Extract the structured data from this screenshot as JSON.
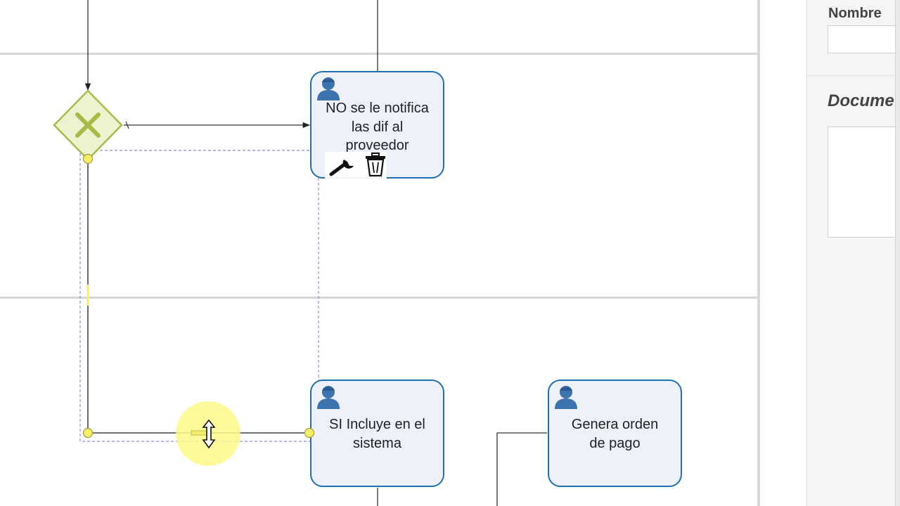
{
  "diagram": {
    "tasks": [
      {
        "id": "notifica",
        "label_lines": [
          "NO se le notifica",
          "las dif al",
          "proveedor"
        ]
      },
      {
        "id": "incluye",
        "label_lines": [
          "SI Incluye en el",
          "sistema"
        ]
      },
      {
        "id": "genera",
        "label_lines": [
          "Genera orden",
          "de pago"
        ]
      }
    ],
    "gateway": {
      "type": "exclusive",
      "symbol": "X",
      "icon": "exclusive-gateway-icon"
    },
    "context_tools": {
      "edit_icon": "wrench-icon",
      "delete_icon": "trash-icon"
    },
    "cursor_icon": "vertical-resize-cursor-icon",
    "colors": {
      "task_border": "#1f6fb2",
      "task_fill": "#eef1fa",
      "user_icon": "#3e74ad",
      "gateway_border": "#a8ba4a",
      "gateway_fill": "#eef3cf",
      "selection": "#8f8fd6",
      "cursor_highlight": "#fbf98a"
    }
  },
  "properties_panel": {
    "name_label": "Nombre",
    "name_value": "",
    "doc_label": "Docume",
    "doc_value": ""
  }
}
